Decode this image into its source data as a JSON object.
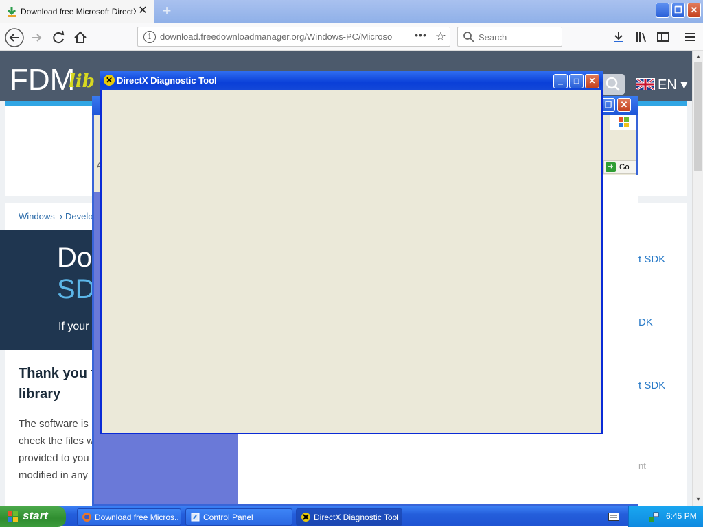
{
  "browser": {
    "tab_title": "Download free Microsoft DirectX S",
    "tab_close": "✕",
    "new_tab": "+",
    "url": "download.freedownloadmanager.org/Windows-PC/Microso",
    "search_placeholder": "Search",
    "page_actions": "•••"
  },
  "site": {
    "logo_main": "FDM",
    "logo_sub": "lib",
    "lang": "EN",
    "breadcrumb_windows": "Windows",
    "breadcrumb_sep": "›",
    "breadcrumb_dev": "Develo",
    "hero_line1": "Dow",
    "hero_line2": "SDK",
    "hero_sub": "If your",
    "thank_line1": "Thank you fo",
    "thank_line2": "library",
    "body_lines": [
      "The software is",
      "check the files w",
      "provided to you",
      "modified in any"
    ],
    "right_links": [
      "t SDK",
      "DK",
      "t SDK"
    ],
    "right_faint": "nt"
  },
  "control_panel": {
    "go_label": "Go",
    "address_prefix": "A"
  },
  "dxdiag": {
    "title": "DirectX Diagnostic Tool"
  },
  "taskbar": {
    "start_label": "start",
    "tasks": [
      {
        "label": "Download free Micros..."
      },
      {
        "label": "Control Panel"
      },
      {
        "label": "DirectX Diagnostic Tool"
      }
    ],
    "clock": "6:45 PM"
  },
  "colors": {
    "xp_titlebar": "#0a3fd8",
    "taskbar": "#245edb",
    "start_green": "#2f8d2f",
    "site_header": "#4c5a6c",
    "link_blue": "#2a7bc8"
  }
}
